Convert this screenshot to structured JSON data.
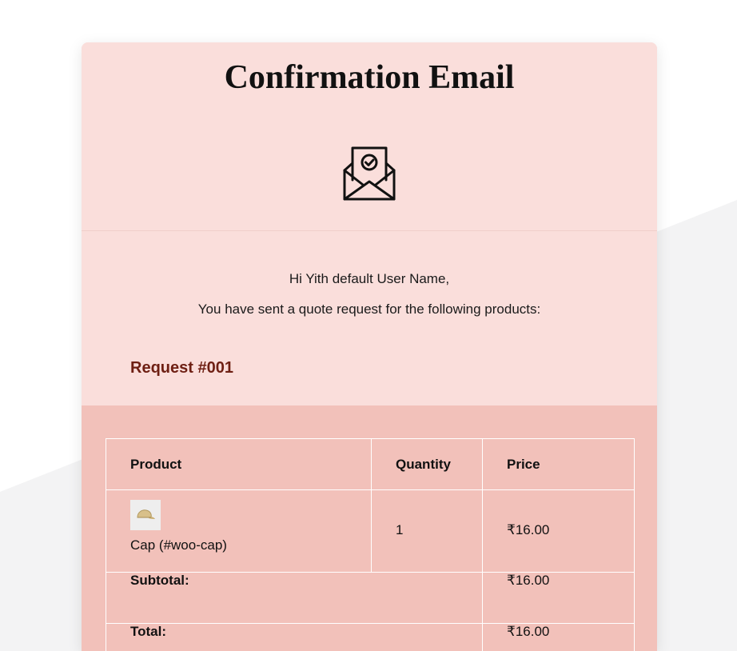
{
  "email": {
    "title": "Confirmation Email",
    "greeting": "Hi Yith default User Name,",
    "intro": "You have sent a quote request for the following products:",
    "request_label": "Request #001"
  },
  "table": {
    "headers": [
      "Product",
      "Quantity",
      "Price"
    ],
    "items": [
      {
        "name": "Cap (#woo-cap)",
        "quantity": "1",
        "price": "₹16.00"
      }
    ],
    "subtotal_label": "Subtotal:",
    "subtotal_value": "₹16.00",
    "total_label": "Total:",
    "total_value": "₹16.00"
  },
  "icons": {
    "header_icon": "envelope-check-icon",
    "product_thumb": "cap-image"
  },
  "colors": {
    "card_background": "#fadedb",
    "table_background": "#f2c1ba",
    "request_label": "#6e1f13"
  }
}
